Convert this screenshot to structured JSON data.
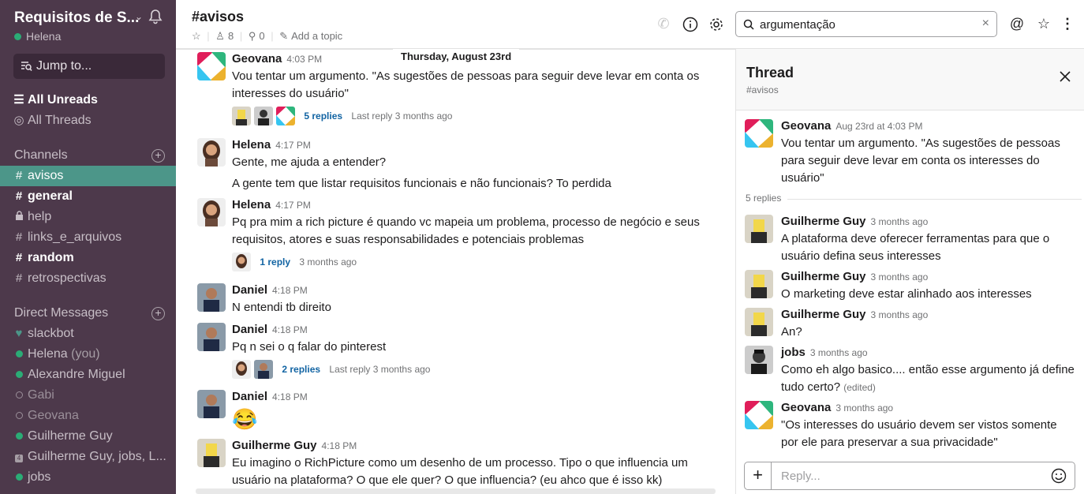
{
  "workspace": {
    "name": "Requisitos de S...",
    "user": "Helena",
    "jump_label": "Jump to..."
  },
  "nav": {
    "all_unreads": "All Unreads",
    "all_threads": "All Threads",
    "channels_label": "Channels",
    "channels": [
      {
        "prefix": "#",
        "label": "avisos",
        "state": "active"
      },
      {
        "prefix": "#",
        "label": "general",
        "state": "bold"
      },
      {
        "prefix": "lock",
        "label": "help",
        "state": "normal"
      },
      {
        "prefix": "#",
        "label": "links_e_arquivos",
        "state": "normal"
      },
      {
        "prefix": "#",
        "label": "random",
        "state": "bold"
      },
      {
        "prefix": "#",
        "label": "retrospectivas",
        "state": "normal"
      }
    ],
    "dm_label": "Direct Messages",
    "dms": [
      {
        "label": "slackbot",
        "suffix": "",
        "status": "heart"
      },
      {
        "label": "Helena",
        "suffix": "(you)",
        "status": "online"
      },
      {
        "label": "Alexandre Miguel",
        "suffix": "",
        "status": "online"
      },
      {
        "label": "Gabi",
        "suffix": "",
        "status": "away"
      },
      {
        "label": "Geovana",
        "suffix": "",
        "status": "away"
      },
      {
        "label": "Guilherme Guy",
        "suffix": "",
        "status": "online"
      },
      {
        "label": "Guilherme Guy, jobs, L...",
        "suffix": "",
        "status": "group"
      },
      {
        "label": "jobs",
        "suffix": "",
        "status": "online"
      }
    ]
  },
  "channel": {
    "title": "#avisos",
    "members": "8",
    "pins": "0",
    "add_topic": "Add a topic",
    "date_divider": "Thursday, August 23rd"
  },
  "search": {
    "value": "argumentação"
  },
  "messages": [
    {
      "author": "Geovana",
      "time": "4:03 PM",
      "text": "Vou tentar um argumento. \"As sugestões de pessoas para seguir deve levar em conta os interesses do usuário\"",
      "replies": "5 replies",
      "last_reply": "Last reply 3 months ago"
    },
    {
      "author": "Helena",
      "time": "4:17 PM",
      "text": "Gente, me ajuda a entender?",
      "text2": "A gente tem que listar requisitos funcionais e não funcionais? To perdida"
    },
    {
      "author": "Helena",
      "time": "4:17 PM",
      "text": "Pq pra mim a rich picture é quando vc mapeia um problema, processo de negócio e seus requisitos, atores e suas responsabilidades e potenciais problemas",
      "replies": "1 reply",
      "last_reply": "3 months ago"
    },
    {
      "author": "Daniel",
      "time": "4:18 PM",
      "text": "N entendi tb direito"
    },
    {
      "author": "Daniel",
      "time": "4:18 PM",
      "text": "Pq n sei o q falar do pinterest",
      "replies": "2 replies",
      "last_reply": "Last reply 3 months ago"
    },
    {
      "author": "Daniel",
      "time": "4:18 PM",
      "text": "😂"
    },
    {
      "author": "Guilherme Guy",
      "time": "4:18 PM",
      "text": "Eu imagino o RichPicture como um desenho de um processo. Tipo o que influencia um usuário na plataforma? O que ele quer? O que influencia?  (eu ahco que é isso kk)"
    }
  ],
  "thread": {
    "title": "Thread",
    "channel": "#avisos",
    "parent": {
      "author": "Geovana",
      "time": "Aug 23rd at 4:03 PM",
      "text": "Vou tentar um argumento. \"As sugestões de pessoas para seguir deve levar em conta os interesses do usuário\""
    },
    "reply_count": "5 replies",
    "replies": [
      {
        "author": "Guilherme Guy",
        "time": "3 months ago",
        "text": "A plataforma deve oferecer ferramentas para que o usuário defina seus interesses"
      },
      {
        "author": "Guilherme Guy",
        "time": "3 months ago",
        "text": "O marketing deve  estar alinhado aos interesses"
      },
      {
        "author": "Guilherme Guy",
        "time": "3 months ago",
        "text": "An?"
      },
      {
        "author": "jobs",
        "time": "3 months ago",
        "text": "Como eh algo basico.... então esse argumento já define tudo certo?",
        "edited": "(edited)"
      },
      {
        "author": "Geovana",
        "time": "3 months ago",
        "text": "\"Os interesses do usuário devem ser vistos somente por ele para preservar a sua privacidade\""
      }
    ],
    "reply_placeholder": "Reply..."
  },
  "colors": {
    "sidebar": "#4d394b",
    "active_channel": "#4c9689",
    "link": "#1264a3",
    "online": "#2bac76"
  }
}
